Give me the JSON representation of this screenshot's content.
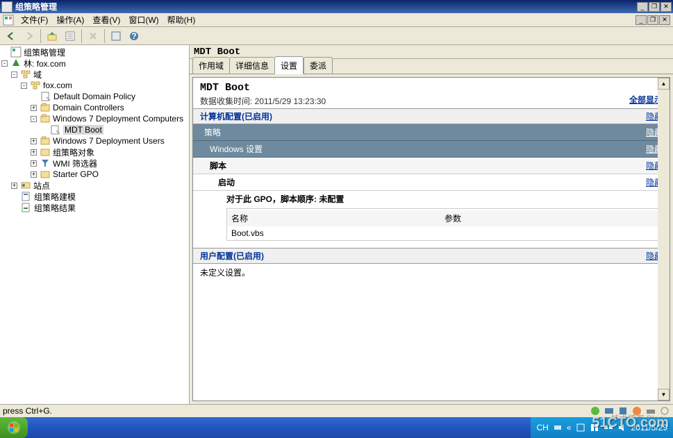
{
  "window": {
    "title": "组策略管理"
  },
  "menu": {
    "file": "文件(F)",
    "action": "操作(A)",
    "view": "查看(V)",
    "window": "窗口(W)",
    "help": "帮助(H)"
  },
  "tree": {
    "root": "组策略管理",
    "forest_prefix": "林: ",
    "forest": "fox.com",
    "domains": "域",
    "domain": "fox.com",
    "items": [
      {
        "label": "Default Domain Policy"
      },
      {
        "label": "Domain Controllers"
      },
      {
        "label": "Windows 7 Deployment Computers"
      },
      {
        "label": "MDT Boot"
      },
      {
        "label": "Windows 7 Deployment Users"
      },
      {
        "label": "组策略对象"
      },
      {
        "label": "WMI 筛选器"
      },
      {
        "label": "Starter GPO"
      }
    ],
    "sites": "站点",
    "modeling": "组策略建模",
    "results": "组策略结果"
  },
  "content": {
    "header": "MDT Boot",
    "tabs": {
      "scope": "作用域",
      "details": "详细信息",
      "settings": "设置",
      "delegation": "委派"
    },
    "panel": {
      "title": "MDT Boot",
      "collected_label": "数据收集时间: ",
      "collected_value": "2011/5/29 13:23:30",
      "show_all": "全部显示",
      "hide": "隐藏",
      "comp_config": "计算机配置(已启用)",
      "policies": "策略",
      "win_settings": "Windows 设置",
      "scripts": "脚本",
      "startup": "启动",
      "order": "对于此 GPO，脚本顺序: 未配置",
      "col_name": "名称",
      "col_params": "参数",
      "vbs": "Boot.vbs",
      "user_config": "用户配置(已启用)",
      "no_settings": "未定义设置。"
    }
  },
  "status": {
    "left": "press Ctrl+G."
  },
  "taskbar": {
    "lang": "CH",
    "date": "2011/5/29"
  },
  "watermark": "51CTO.com",
  "watermark2": "技术博客  Blog"
}
